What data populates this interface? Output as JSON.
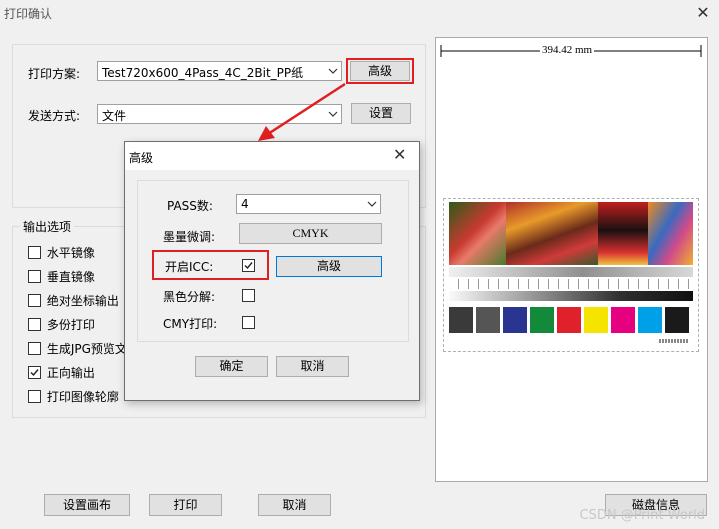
{
  "window": {
    "title": "打印确认"
  },
  "plan": {
    "label": "打印方案:",
    "value": "Test720x600_4Pass_4C_2Bit_PP纸",
    "advanced": "高级"
  },
  "send": {
    "label": "发送方式:",
    "value": "文件",
    "settings": "设置"
  },
  "output": {
    "group_label": "输出选项",
    "options": [
      "水平镜像",
      "垂直镜像",
      "绝对坐标输出",
      "多份打印",
      "生成JPG预览文件",
      "正向输出",
      "打印图像轮廓"
    ],
    "checked": [
      false,
      false,
      false,
      false,
      false,
      true,
      false
    ]
  },
  "bottom": {
    "set_canvas": "设置画布",
    "print": "打印",
    "cancel": "取消",
    "disk_info": "磁盘信息"
  },
  "preview": {
    "width_label": "394.42 mm"
  },
  "dialog": {
    "title": "高级",
    "pass_label": "PASS数:",
    "pass_value": "4",
    "ink_label": "墨量微调:",
    "ink_button": "CMYK",
    "icc_label": "开启ICC:",
    "icc_checked": true,
    "icc_advanced": "高级",
    "black_label": "黑色分解:",
    "black_checked": false,
    "cmy_label": "CMY打印:",
    "cmy_checked": false,
    "ok": "确定",
    "cancel": "取消"
  },
  "colors": {
    "highlight": "#e02020",
    "focus": "#0078d7",
    "swatches": [
      "#3a3a3a",
      "#555555",
      "#2a3590",
      "#138a3a",
      "#e0202a",
      "#f5e400",
      "#e4007f",
      "#00a0e9",
      "#1a1a1a"
    ]
  },
  "watermark": "CSDN @Print World"
}
